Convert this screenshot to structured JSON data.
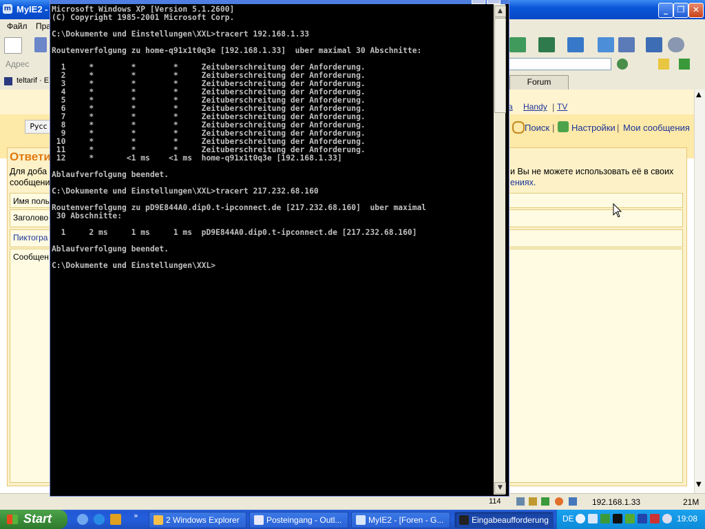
{
  "browser": {
    "title": "MyIE2 -",
    "menu": [
      "Файл",
      "Пра"
    ],
    "address_label": "Адрес",
    "tabs": [
      "teltarif · E",
      "Forum"
    ],
    "content": {
      "nav_links": [
        "a",
        "Handy",
        "TV"
      ],
      "search_link": "Поиск",
      "settings_link": "Настройки",
      "messages_link": "Мои сообщения",
      "lang_btn": "Русс",
      "reply_heading": "Ответи",
      "notice_left_1": "Для доба",
      "notice_left_2": "сообщени",
      "notice_right_1": "и Вы не можете использовать её в своих",
      "notice_right_2": "ениях.",
      "form_rows": [
        "Имя поль",
        "Заголово",
        "Пиктогра",
        "Сообщен"
      ]
    },
    "status": {
      "count": "114",
      "ip": "192.168.1.33",
      "memory": "21M"
    }
  },
  "console": {
    "lines": [
      "Microsoft Windows XP [Version 5.1.2600]",
      "(C) Copyright 1985-2001 Microsoft Corp.",
      "",
      "C:\\Dokumente und Einstellungen\\XXL>tracert 192.168.1.33",
      "",
      "Routenverfolgung zu home-q91x1t0q3e [192.168.1.33]  uber maximal 30 Abschnitte:",
      "",
      "  1     *        *        *     Zeituberschreitung der Anforderung.",
      "  2     *        *        *     Zeituberschreitung der Anforderung.",
      "  3     *        *        *     Zeituberschreitung der Anforderung.",
      "  4     *        *        *     Zeituberschreitung der Anforderung.",
      "  5     *        *        *     Zeituberschreitung der Anforderung.",
      "  6     *        *        *     Zeituberschreitung der Anforderung.",
      "  7     *        *        *     Zeituberschreitung der Anforderung.",
      "  8     *        *        *     Zeituberschreitung der Anforderung.",
      "  9     *        *        *     Zeituberschreitung der Anforderung.",
      " 10     *        *        *     Zeituberschreitung der Anforderung.",
      " 11     *        *        *     Zeituberschreitung der Anforderung.",
      " 12     *       <1 ms    <1 ms  home-q91x1t0q3e [192.168.1.33]",
      "",
      "Ablaufverfolgung beendet.",
      "",
      "C:\\Dokumente und Einstellungen\\XXL>tracert 217.232.68.160",
      "",
      "Routenverfolgung zu pD9E844A0.dip0.t-ipconnect.de [217.232.68.160]  uber maximal",
      " 30 Abschnitte:",
      "",
      "  1     2 ms     1 ms     1 ms  pD9E844A0.dip0.t-ipconnect.de [217.232.68.160]",
      "",
      "Ablaufverfolgung beendet.",
      "",
      "C:\\Dokumente und Einstellungen\\XXL>"
    ]
  },
  "taskbar": {
    "start_label": "Start",
    "tasks": [
      {
        "label": "2 Windows Explorer",
        "icon_color": "#f4c04a"
      },
      {
        "label": "Posteingang - Outl...",
        "icon_color": "#e8e8f8"
      },
      {
        "label": "MyIE2 - [Foren - G...",
        "icon_color": "#d9e6fa"
      },
      {
        "label": "Eingabeaufforderung",
        "icon_color": "#222222"
      }
    ],
    "tray_lang": "DE",
    "clock": "19:08"
  }
}
